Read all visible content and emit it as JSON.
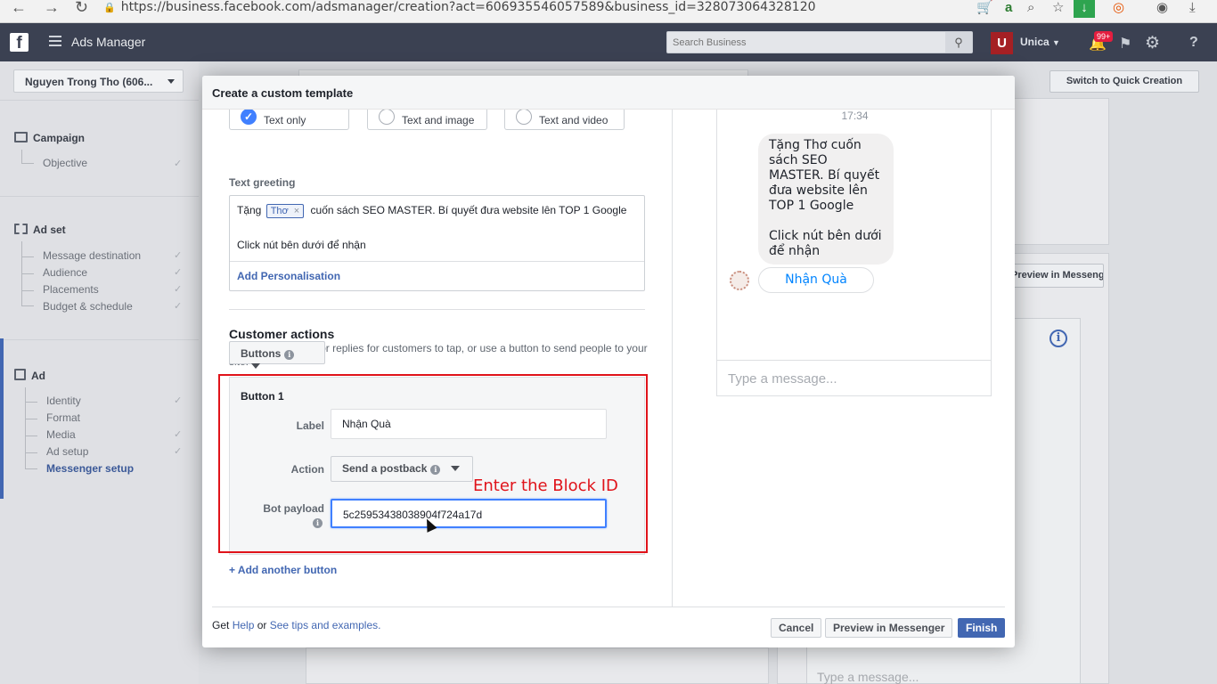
{
  "browser": {
    "url": "https://business.facebook.com/adsmanager/creation?act=606935546057589&business_id=328073064328120"
  },
  "topbar": {
    "app_title": "Ads Manager",
    "search_placeholder": "Search Business",
    "user_initial": "U",
    "user_name": "Unica",
    "notif_badge": "99+"
  },
  "sidebar": {
    "account": "Nguyen Trong Tho (606...",
    "campaign": {
      "title": "Campaign",
      "items": [
        "Objective"
      ]
    },
    "adset": {
      "title": "Ad set",
      "items": [
        "Message destination",
        "Audience",
        "Placements",
        "Budget & schedule"
      ]
    },
    "ad": {
      "title": "Ad",
      "items": [
        "Identity",
        "Format",
        "Media",
        "Ad setup",
        "Messenger setup"
      ]
    }
  },
  "background": {
    "switch_button": "Switch to Quick Creation",
    "preview_button": "Preview in Messenger",
    "type_placeholder": "Type a message..."
  },
  "modal": {
    "title": "Create a custom template",
    "formats": [
      "Text only",
      "Text and image",
      "Text and video"
    ],
    "text_greeting_label": "Text greeting",
    "greeting_prefix": "Tặng",
    "greeting_token": "Thơ",
    "greeting_suffix": "cuốn sách SEO MASTER. Bí quyết đưa website lên TOP 1 Google",
    "greeting_line2": "Click nút bên dưới để nhận",
    "add_personalisation": "Add Personalisation",
    "customer_actions_title": "Customer actions",
    "customer_actions_desc": "Suggest questions or replies for customers to tap, or use a button to send people to your site.",
    "buttons_select": "Buttons",
    "button1": {
      "title": "Button 1",
      "label_label": "Label",
      "label_value": "Nhận Quà",
      "action_label": "Action",
      "action_value": "Send a postback",
      "payload_label": "Bot payload",
      "payload_value": "5c25953438038904f724a17d"
    },
    "add_another_button": "+ Add another button",
    "annotation": "Enter the Block ID",
    "preview": {
      "time": "17:34",
      "bubble_line1": "Tặng Thơ  cuốn sách SEO MASTER. Bí quyết đưa website lên TOP 1 Google",
      "bubble_line2": "Click nút bên dưới để nhận",
      "quick_reply": "Nhận Quà",
      "input_placeholder": "Type a message..."
    },
    "footer": {
      "get": "Get",
      "help": "Help",
      "or": "or",
      "tips": "See tips and examples.",
      "cancel": "Cancel",
      "preview": "Preview in Messenger",
      "finish": "Finish"
    }
  }
}
